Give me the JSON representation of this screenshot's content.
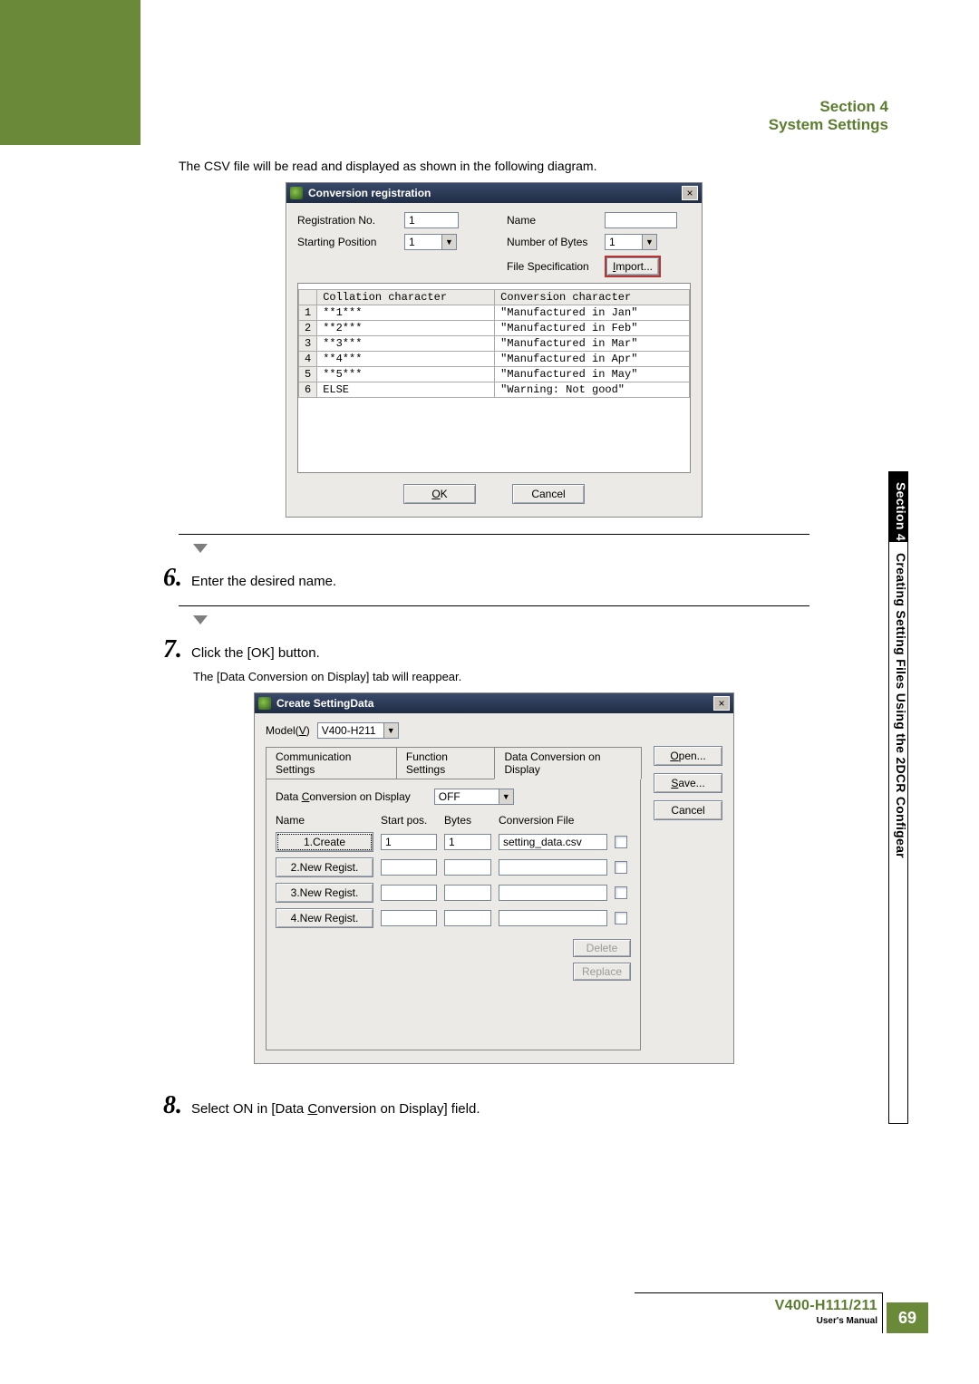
{
  "header": {
    "section": "Section 4",
    "title": "System Settings"
  },
  "intro": "The CSV file will be read and displayed as shown in the following diagram.",
  "dialog1": {
    "title": "Conversion registration",
    "reg_no_label": "Registration No.",
    "reg_no_value": "1",
    "start_pos_label": "Starting Position",
    "start_pos_value": "1",
    "name_label": "Name",
    "name_value": "",
    "bytes_label": "Number of Bytes",
    "bytes_value": "1",
    "file_spec_label": "File Specification",
    "import_label": "Import...",
    "col1_header": "Collation character",
    "col2_header": "Conversion character",
    "rows": [
      {
        "idx": "1",
        "col": "**1***",
        "conv": "\"Manufactured in Jan\""
      },
      {
        "idx": "2",
        "col": "**2***",
        "conv": "\"Manufactured in Feb\""
      },
      {
        "idx": "3",
        "col": "**3***",
        "conv": "\"Manufactured in Mar\""
      },
      {
        "idx": "4",
        "col": "**4***",
        "conv": "\"Manufactured in Apr\""
      },
      {
        "idx": "5",
        "col": "**5***",
        "conv": "\"Manufactured in May\""
      },
      {
        "idx": "6",
        "col": "ELSE",
        "conv": "\"Warning: Not good\""
      }
    ],
    "ok": "OK",
    "cancel": "Cancel"
  },
  "step6": {
    "num": "6.",
    "text": "Enter the desired name."
  },
  "step7": {
    "num": "7.",
    "text": "Click the [OK] button.",
    "sub": "The [Data Conversion on Display] tab will reappear."
  },
  "dialog2": {
    "title": "Create SettingData",
    "model_label_pre": "Model(",
    "model_label_u": "V",
    "model_label_post": ")",
    "model_value": "V400-H211",
    "tab1": "Communication Settings",
    "tab2": "Function Settings",
    "tab3": "Data Conversion on Display",
    "dc_label_pre": "Data ",
    "dc_label_u": "C",
    "dc_label_post": "onversion on Display",
    "dc_value": "OFF",
    "hdr_name": "Name",
    "hdr_start": "Start pos.",
    "hdr_bytes": "Bytes",
    "hdr_file": "Conversion File",
    "rows": [
      {
        "name": "1.Create",
        "start": "1",
        "bytes": "1",
        "file": "setting_data.csv"
      },
      {
        "name": "2.New Regist.",
        "start": "",
        "bytes": "",
        "file": ""
      },
      {
        "name": "3.New Regist.",
        "start": "",
        "bytes": "",
        "file": ""
      },
      {
        "name": "4.New Regist.",
        "start": "",
        "bytes": "",
        "file": ""
      }
    ],
    "delete": "Delete",
    "replace": "Replace",
    "open_u": "O",
    "open_rest": "pen...",
    "save_u": "S",
    "save_rest": "ave...",
    "cancel": "Cancel"
  },
  "step8": {
    "num": "8.",
    "pre": "Select ON in [Data ",
    "u": "C",
    "post": "onversion on Display] field."
  },
  "side": {
    "white": "Section 4",
    "black": "Creating Setting Files Using the 2DCR Configear"
  },
  "footer": {
    "model": "V400-H111/211",
    "manual": "User's Manual",
    "page": "69"
  }
}
